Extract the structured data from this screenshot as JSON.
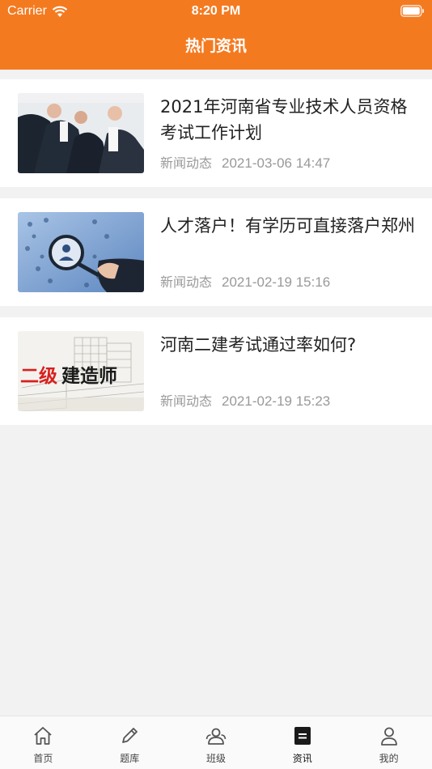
{
  "status_bar": {
    "carrier": "Carrier",
    "time": "8:20 PM"
  },
  "header": {
    "title": "热门资讯"
  },
  "news": [
    {
      "title": "2021年河南省专业技术人员资格考试工作计划",
      "category": "新闻动态",
      "date": "2021-03-06 14:47",
      "thumb": "business-people-photo"
    },
    {
      "title": "人才落户！有学历可直接落户郑州",
      "category": "新闻动态",
      "date": "2021-02-19 15:16",
      "thumb": "magnifier-people-network-photo"
    },
    {
      "title": "河南二建考试通过率如何?",
      "category": "新闻动态",
      "date": "2021-02-19 15:23",
      "thumb": "building-sketch-photo",
      "thumb_text": {
        "red": "二级",
        "black": "建造师"
      }
    }
  ],
  "tabs": [
    {
      "label": "首页",
      "icon": "home-icon"
    },
    {
      "label": "题库",
      "icon": "pencil-icon"
    },
    {
      "label": "班级",
      "icon": "group-icon"
    },
    {
      "label": "资讯",
      "icon": "document-icon",
      "active": true
    },
    {
      "label": "我的",
      "icon": "user-icon"
    }
  ],
  "colors": {
    "accent": "#f47a20",
    "background": "#f2f2f2",
    "meta_text": "#999999"
  }
}
